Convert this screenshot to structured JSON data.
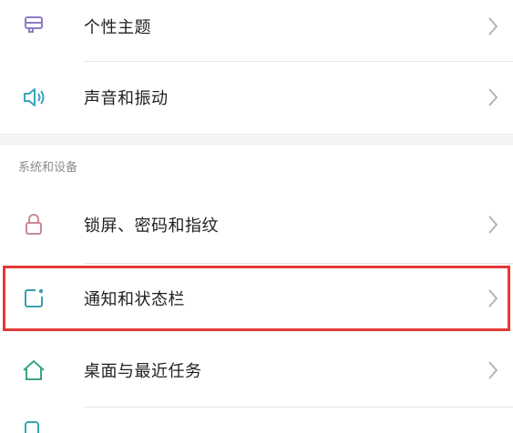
{
  "items_top": [
    {
      "label": "个性主题",
      "icon": "theme-icon",
      "color": "#8e7cc3"
    },
    {
      "label": "声音和振动",
      "icon": "speaker-icon",
      "color": "#3aa6b9"
    }
  ],
  "section": {
    "title": "系统和设备"
  },
  "items_bottom": [
    {
      "label": "锁屏、密码和指纹",
      "icon": "lock-icon",
      "color": "#c98a93"
    },
    {
      "label": "通知和状态栏",
      "icon": "notification-icon",
      "color": "#3a9fb0"
    },
    {
      "label": "桌面与最近任务",
      "icon": "home-icon",
      "color": "#3aa67f"
    }
  ],
  "colors": {
    "highlight": "#e53935",
    "chevron": "#b5b5b5"
  }
}
